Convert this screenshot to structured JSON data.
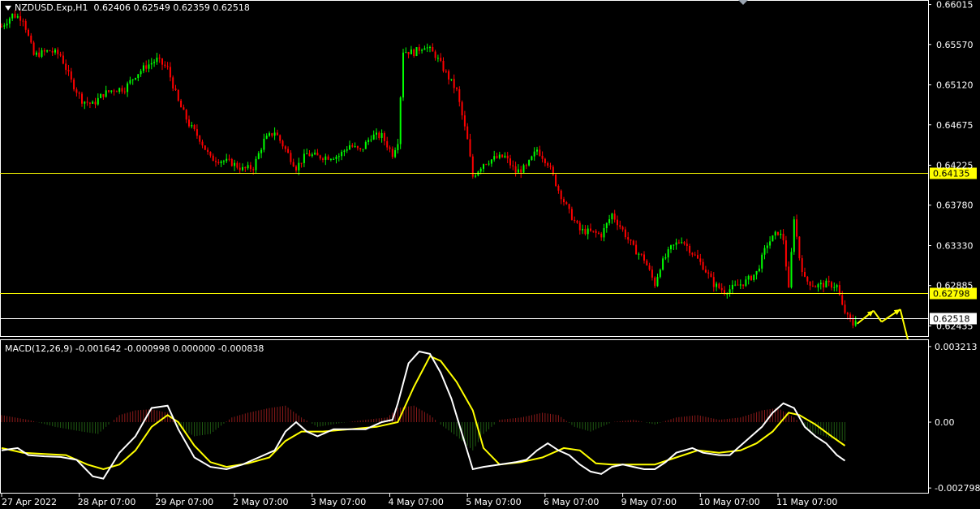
{
  "header": {
    "symbol": "NZDUSD.Exp,H1",
    "ohlc": "0.62406 0.62549 0.62359 0.62518"
  },
  "macd_header": {
    "text": "MACD(12,26,9) -0.001642 -0.000998 0.000000 -0.000838"
  },
  "colors": {
    "background": "#000000",
    "bull": "#00ff00",
    "bear": "#ff0000",
    "level_line": "#ffff00",
    "signal_line": "#ffff00",
    "macd_line": "#ffffff",
    "hist_pos": "#8b1a1a",
    "hist_neg": "#1f5a12",
    "arrows": "#ffff00"
  },
  "chart_data": [
    {
      "type": "candlestick",
      "title": "NZDUSD.Exp,H1",
      "ylim": [
        0.6234,
        0.6602
      ],
      "y_ticks": [
        "0.66015",
        "0.65570",
        "0.65120",
        "0.64675",
        "0.64225",
        "0.63780",
        "0.63330",
        "0.62885",
        "0.62435"
      ],
      "x_labels": [
        "27 Apr 2022",
        "28 Apr 07:00",
        "29 Apr 07:00",
        "2 May 07:00",
        "3 May 07:00",
        "4 May 07:00",
        "5 May 07:00",
        "6 May 07:00",
        "9 May 07:00",
        "10 May 07:00",
        "11 May 07:00"
      ],
      "levels": [
        {
          "value": 0.64135,
          "label": "0.64135",
          "style": "yellow"
        },
        {
          "value": 0.62798,
          "label": "0.62798",
          "style": "yellow"
        },
        {
          "value": 0.62518,
          "label": "0.62518",
          "style": "white"
        }
      ],
      "price_path": [
        [
          0,
          0.6577
        ],
        [
          4,
          0.659
        ],
        [
          8,
          0.6586
        ],
        [
          12,
          0.6545
        ],
        [
          18,
          0.655
        ],
        [
          22,
          0.6545
        ],
        [
          26,
          0.6516
        ],
        [
          30,
          0.6495
        ],
        [
          34,
          0.649
        ],
        [
          38,
          0.6502
        ],
        [
          42,
          0.6507
        ],
        [
          46,
          0.6508
        ],
        [
          50,
          0.6523
        ],
        [
          54,
          0.6533
        ],
        [
          58,
          0.654
        ],
        [
          62,
          0.653
        ],
        [
          66,
          0.6493
        ],
        [
          70,
          0.6468
        ],
        [
          74,
          0.6452
        ],
        [
          78,
          0.643
        ],
        [
          82,
          0.6428
        ],
        [
          86,
          0.6425
        ],
        [
          90,
          0.6418
        ],
        [
          94,
          0.642
        ],
        [
          98,
          0.645
        ],
        [
          102,
          0.646
        ],
        [
          106,
          0.644
        ],
        [
          110,
          0.642
        ],
        [
          114,
          0.6435
        ],
        [
          118,
          0.6432
        ],
        [
          122,
          0.6432
        ],
        [
          126,
          0.6433
        ],
        [
          130,
          0.6445
        ],
        [
          134,
          0.6438
        ],
        [
          138,
          0.6455
        ],
        [
          142,
          0.6455
        ],
        [
          146,
          0.6435
        ],
        [
          148,
          0.645
        ],
        [
          150,
          0.655
        ],
        [
          154,
          0.6548
        ],
        [
          158,
          0.6556
        ],
        [
          162,
          0.6545
        ],
        [
          166,
          0.6525
        ],
        [
          170,
          0.6505
        ],
        [
          174,
          0.645
        ],
        [
          176,
          0.641
        ],
        [
          180,
          0.6425
        ],
        [
          184,
          0.643
        ],
        [
          188,
          0.6432
        ],
        [
          192,
          0.6415
        ],
        [
          196,
          0.642
        ],
        [
          200,
          0.644
        ],
        [
          204,
          0.6425
        ],
        [
          208,
          0.6395
        ],
        [
          212,
          0.637
        ],
        [
          216,
          0.635
        ],
        [
          220,
          0.6348
        ],
        [
          224,
          0.6345
        ],
        [
          228,
          0.6368
        ],
        [
          232,
          0.635
        ],
        [
          236,
          0.633
        ],
        [
          240,
          0.6318
        ],
        [
          244,
          0.629
        ],
        [
          246,
          0.631
        ],
        [
          250,
          0.633
        ],
        [
          254,
          0.634
        ],
        [
          258,
          0.6325
        ],
        [
          262,
          0.631
        ],
        [
          266,
          0.629
        ],
        [
          270,
          0.6282
        ],
        [
          274,
          0.6287
        ],
        [
          278,
          0.6293
        ],
        [
          282,
          0.6303
        ],
        [
          286,
          0.6335
        ],
        [
          290,
          0.6348
        ],
        [
          292,
          0.634
        ],
        [
          294,
          0.6283
        ],
        [
          296,
          0.6365
        ],
        [
          298,
          0.632
        ],
        [
          300,
          0.6295
        ],
        [
          304,
          0.6288
        ],
        [
          308,
          0.629
        ],
        [
          312,
          0.6288
        ],
        [
          314,
          0.6265
        ],
        [
          316,
          0.6253
        ],
        [
          318,
          0.6245
        ],
        [
          319,
          0.6252
        ]
      ]
    },
    {
      "type": "macd",
      "title": "MACD(12,26,9)",
      "values_shown": [
        "-0.001642",
        "-0.000998",
        "0.000000",
        "-0.000838"
      ],
      "ylim": [
        -0.003,
        0.00345
      ],
      "y_ticks": [
        "0.003213",
        "0.00",
        "-0.002798"
      ],
      "macd_line": [
        [
          0,
          -0.0012
        ],
        [
          6,
          -0.0011
        ],
        [
          10,
          -0.0014
        ],
        [
          16,
          -0.00145
        ],
        [
          22,
          -0.00148
        ],
        [
          28,
          -0.0016
        ],
        [
          34,
          -0.0023
        ],
        [
          38,
          -0.0024
        ],
        [
          44,
          -0.0013
        ],
        [
          50,
          -0.0006
        ],
        [
          56,
          0.0006
        ],
        [
          62,
          0.0007
        ],
        [
          66,
          -0.0003
        ],
        [
          72,
          -0.0015
        ],
        [
          78,
          -0.0019
        ],
        [
          84,
          -0.002
        ],
        [
          90,
          -0.0018
        ],
        [
          96,
          -0.0015
        ],
        [
          102,
          -0.0012
        ],
        [
          106,
          -0.0004
        ],
        [
          110,
          0.0
        ],
        [
          114,
          -0.0004
        ],
        [
          118,
          -0.0006
        ],
        [
          124,
          -0.0003
        ],
        [
          130,
          -0.0003
        ],
        [
          136,
          -0.0003
        ],
        [
          142,
          0.0
        ],
        [
          146,
          0.0001
        ],
        [
          148,
          0.0008
        ],
        [
          152,
          0.0025
        ],
        [
          156,
          0.003
        ],
        [
          160,
          0.0029
        ],
        [
          164,
          0.0021
        ],
        [
          168,
          0.001
        ],
        [
          172,
          -0.0005
        ],
        [
          176,
          -0.002
        ],
        [
          180,
          -0.0019
        ],
        [
          186,
          -0.0018
        ],
        [
          192,
          -0.0017
        ],
        [
          196,
          -0.0016
        ],
        [
          200,
          -0.0012
        ],
        [
          204,
          -0.0009
        ],
        [
          208,
          -0.0012
        ],
        [
          212,
          -0.0014
        ],
        [
          216,
          -0.0018
        ],
        [
          220,
          -0.0021
        ],
        [
          224,
          -0.0022
        ],
        [
          228,
          -0.0019
        ],
        [
          232,
          -0.0018
        ],
        [
          236,
          -0.0019
        ],
        [
          240,
          -0.002
        ],
        [
          244,
          -0.002
        ],
        [
          248,
          -0.0017
        ],
        [
          252,
          -0.0013
        ],
        [
          258,
          -0.0011
        ],
        [
          262,
          -0.0013
        ],
        [
          268,
          -0.0014
        ],
        [
          272,
          -0.0014
        ],
        [
          276,
          -0.001
        ],
        [
          280,
          -0.0006
        ],
        [
          284,
          -0.0002
        ],
        [
          288,
          0.0004
        ],
        [
          292,
          0.0008
        ],
        [
          296,
          0.0006
        ],
        [
          300,
          -0.0002
        ],
        [
          304,
          -0.0006
        ],
        [
          308,
          -0.0009
        ],
        [
          312,
          -0.0014
        ],
        [
          315,
          -0.00164
        ]
      ],
      "signal_line": [
        [
          0,
          -0.0011
        ],
        [
          8,
          -0.0013
        ],
        [
          16,
          -0.00135
        ],
        [
          24,
          -0.0014
        ],
        [
          32,
          -0.0018
        ],
        [
          38,
          -0.002
        ],
        [
          44,
          -0.0018
        ],
        [
          50,
          -0.0012
        ],
        [
          56,
          -0.0002
        ],
        [
          62,
          0.0003
        ],
        [
          66,
          0.0
        ],
        [
          72,
          -0.001
        ],
        [
          78,
          -0.0017
        ],
        [
          84,
          -0.0019
        ],
        [
          92,
          -0.00175
        ],
        [
          100,
          -0.0015
        ],
        [
          106,
          -0.0008
        ],
        [
          112,
          -0.0004
        ],
        [
          120,
          -0.0004
        ],
        [
          130,
          -0.0003
        ],
        [
          140,
          -0.0002
        ],
        [
          148,
          0.0
        ],
        [
          154,
          0.0015
        ],
        [
          160,
          0.0028
        ],
        [
          164,
          0.0026
        ],
        [
          170,
          0.0017
        ],
        [
          176,
          0.0005
        ],
        [
          180,
          -0.0011
        ],
        [
          186,
          -0.0018
        ],
        [
          194,
          -0.0017
        ],
        [
          202,
          -0.0015
        ],
        [
          210,
          -0.0011
        ],
        [
          216,
          -0.0012
        ],
        [
          222,
          -0.00175
        ],
        [
          228,
          -0.0018
        ],
        [
          236,
          -0.0018
        ],
        [
          244,
          -0.0018
        ],
        [
          252,
          -0.0015
        ],
        [
          260,
          -0.0012
        ],
        [
          268,
          -0.0013
        ],
        [
          276,
          -0.0012
        ],
        [
          282,
          -0.0009
        ],
        [
          288,
          -0.0004
        ],
        [
          294,
          0.0004
        ],
        [
          298,
          0.0003
        ],
        [
          304,
          -0.0001
        ],
        [
          310,
          -0.0006
        ],
        [
          315,
          -0.001
        ]
      ],
      "histogram": [
        [
          0,
          0.0003
        ],
        [
          10,
          0.0001
        ],
        [
          20,
          -0.0002
        ],
        [
          30,
          -0.0004
        ],
        [
          36,
          -0.0005
        ],
        [
          44,
          0.0003
        ],
        [
          50,
          0.0005
        ],
        [
          56,
          0.00055
        ],
        [
          62,
          0.0004
        ],
        [
          66,
          -0.0002
        ],
        [
          72,
          -0.0006
        ],
        [
          78,
          -0.0005
        ],
        [
          86,
          0.0002
        ],
        [
          92,
          0.0004
        ],
        [
          100,
          0.0006
        ],
        [
          106,
          0.0007
        ],
        [
          112,
          0.0002
        ],
        [
          118,
          -0.0002
        ],
        [
          126,
          -5e-05
        ],
        [
          136,
          0.0001
        ],
        [
          144,
          0.0002
        ],
        [
          148,
          0.0006
        ],
        [
          154,
          0.0007
        ],
        [
          160,
          0.0003
        ],
        [
          164,
          -0.0001
        ],
        [
          170,
          -0.0006
        ],
        [
          176,
          -0.0012
        ],
        [
          180,
          -0.0005
        ],
        [
          186,
          0.0001
        ],
        [
          194,
          0.0002
        ],
        [
          202,
          0.0004
        ],
        [
          208,
          0.0003
        ],
        [
          214,
          -0.0002
        ],
        [
          220,
          -0.0004
        ],
        [
          228,
          0.0
        ],
        [
          236,
          0.0001
        ],
        [
          244,
          -0.0001
        ],
        [
          252,
          0.0002
        ],
        [
          260,
          0.0003
        ],
        [
          268,
          0.0001
        ],
        [
          276,
          0.0002
        ],
        [
          284,
          0.0005
        ],
        [
          290,
          0.0006
        ],
        [
          296,
          0.0002
        ],
        [
          302,
          -0.0004
        ],
        [
          310,
          -0.0007
        ],
        [
          315,
          -0.0008
        ]
      ]
    }
  ]
}
